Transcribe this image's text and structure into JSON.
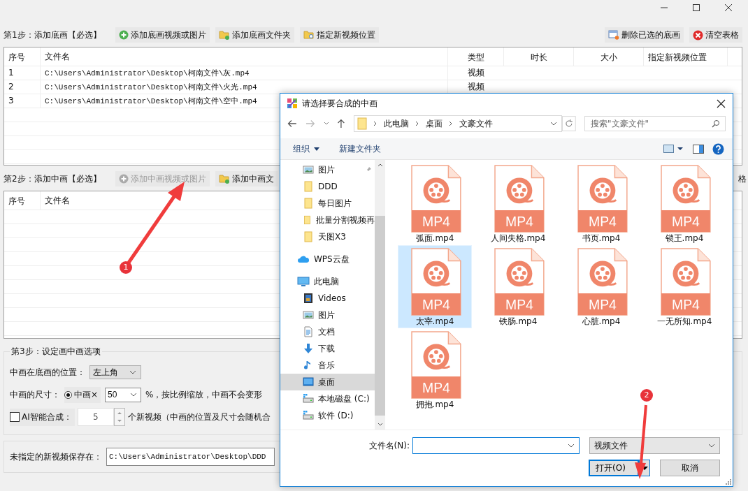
{
  "step1": {
    "label": "第1步：添加底画【必选】",
    "buttons": [
      {
        "label": "添加底画视频或图片",
        "kind": "add",
        "disabled": false
      },
      {
        "label": "添加底画文件夹",
        "kind": "folder",
        "disabled": false
      },
      {
        "label": "指定新视频位置",
        "kind": "locate",
        "disabled": false
      }
    ],
    "right_buttons": [
      {
        "label": "删除已选的底画",
        "kind": "remove"
      },
      {
        "label": "清空表格",
        "kind": "clear"
      }
    ],
    "table": {
      "columns": [
        "序号",
        "文件名",
        "类型",
        "时长",
        "大小",
        "指定新视频位置"
      ],
      "rows": [
        {
          "index": "1",
          "file": "C:\\Users\\Administrator\\Desktop\\柯南文件\\灰.mp4",
          "type": "视频"
        },
        {
          "index": "2",
          "file": "C:\\Users\\Administrator\\Desktop\\柯南文件\\火光.mp4",
          "type": "视频"
        },
        {
          "index": "3",
          "file": "C:\\Users\\Administrator\\Desktop\\柯南文件\\空中.mp4"
        }
      ]
    }
  },
  "step2": {
    "label": "第2步：添加中画【必选】",
    "buttons": [
      {
        "label": "添加中画视频或图片",
        "kind": "add",
        "disabled": true
      },
      {
        "label": "添加中画文",
        "kind": "folder",
        "disabled": false
      }
    ],
    "right_text": "格",
    "table": {
      "columns": [
        "序号",
        "文件名"
      ]
    }
  },
  "step3": {
    "legend": "第3步：设定画中画选项",
    "position": {
      "label": "中画在底画的位置：",
      "value": "左上角"
    },
    "size": {
      "label": "中画的尺寸：",
      "option": "中画×",
      "selected": true,
      "value": "50",
      "note": "%，按比例缩放，中画不会变形"
    },
    "ai": {
      "label": "AI智能合成：",
      "checked": false,
      "value": "5",
      "note": "个新视频（中画的位置及尺寸会随机合"
    }
  },
  "save": {
    "label": "未指定的新视频保存在：",
    "value": "C:\\Users\\Administrator\\Desktop\\DDD"
  },
  "dialog": {
    "title": "请选择要合成的中画",
    "breadcrumb": [
      "此电脑",
      "桌面",
      "文豪文件"
    ],
    "search": {
      "placeholder": "搜索\"文豪文件\""
    },
    "commands": [
      {
        "label": "组织",
        "dropdown": true
      },
      {
        "label": "新建文件夹",
        "dropdown": false
      }
    ],
    "quick_access": [
      {
        "label": "图片",
        "kind": "pictures",
        "pinned": true,
        "selected": false
      },
      {
        "label": "DDD",
        "kind": "folder",
        "pinned": false,
        "selected": false
      },
      {
        "label": "每日图片",
        "kind": "folder",
        "pinned": false,
        "selected": false
      },
      {
        "label": "批量分割视频再",
        "kind": "folder",
        "pinned": false,
        "selected": false
      },
      {
        "label": "天图X3",
        "kind": "folder",
        "pinned": false,
        "selected": false
      }
    ],
    "locations": [
      {
        "label": "WPS云盘",
        "kind": "cloud",
        "selected": false
      },
      {
        "label": "此电脑",
        "kind": "pc",
        "selected": false,
        "children": [
          {
            "label": "Videos",
            "kind": "videos",
            "selected": false
          },
          {
            "label": "图片",
            "kind": "pictures",
            "selected": false
          },
          {
            "label": "文档",
            "kind": "docs",
            "selected": false
          },
          {
            "label": "下载",
            "kind": "downloads",
            "selected": false
          },
          {
            "label": "音乐",
            "kind": "music",
            "selected": false
          },
          {
            "label": "桌面",
            "kind": "desktop",
            "selected": true
          },
          {
            "label": "本地磁盘 (C:)",
            "kind": "drive",
            "selected": false
          },
          {
            "label": "软件 (D:)",
            "kind": "drive",
            "selected": false
          }
        ]
      }
    ],
    "files": [
      {
        "name": "弧面.mp4",
        "badge": "MP4",
        "selected": false
      },
      {
        "name": "人间失格.mp4",
        "badge": "MP4",
        "selected": false
      },
      {
        "name": "书页.mp4",
        "badge": "MP4",
        "selected": false
      },
      {
        "name": "锁王.mp4",
        "badge": "MP4",
        "selected": false
      },
      {
        "name": "太宰.mp4",
        "badge": "MP4",
        "selected": true
      },
      {
        "name": "铁肠.mp4",
        "badge": "MP4",
        "selected": false
      },
      {
        "name": "心脏.mp4",
        "badge": "MP4",
        "selected": false
      },
      {
        "name": "一无所知.mp4",
        "badge": "MP4",
        "selected": false
      },
      {
        "name": "拥抱.mp4",
        "badge": "MP4",
        "selected": false
      }
    ],
    "filename": {
      "label": "文件名(N):"
    },
    "filter": {
      "value": "视频文件"
    },
    "buttons": [
      {
        "label": "打开(O)",
        "kind": "split"
      },
      {
        "label": "取消",
        "kind": "plain"
      }
    ]
  },
  "annotations": [
    {
      "number": "1"
    },
    {
      "number": "2"
    }
  ]
}
